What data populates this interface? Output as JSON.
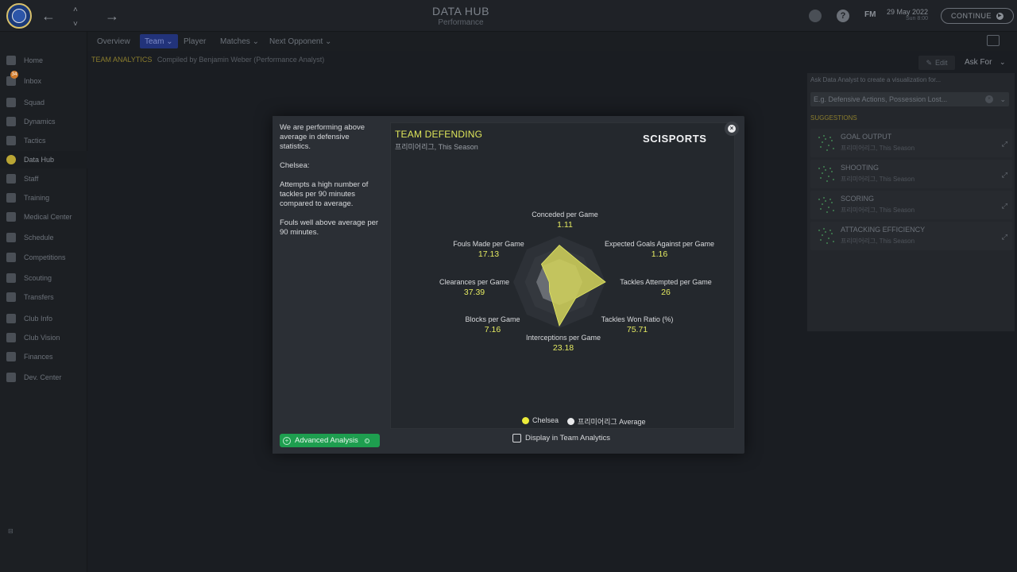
{
  "header": {
    "title": "DATA HUB",
    "subtitle": "Performance",
    "fm_label": "FM",
    "date": "29 May 2022",
    "time": "Sun 8:00",
    "continue_label": "CONTINUE"
  },
  "sidebar": {
    "inbox_count": "34",
    "items": [
      {
        "label": "Home",
        "icon": "home-icon"
      },
      {
        "label": "Inbox",
        "icon": "inbox-icon"
      },
      {
        "label": "Squad",
        "icon": "squad-icon"
      },
      {
        "label": "Dynamics",
        "icon": "dynamics-icon"
      },
      {
        "label": "Tactics",
        "icon": "tactics-icon"
      },
      {
        "label": "Data Hub",
        "icon": "data-hub-icon"
      },
      {
        "label": "Staff",
        "icon": "staff-icon"
      },
      {
        "label": "Training",
        "icon": "training-icon"
      },
      {
        "label": "Medical Center",
        "icon": "medical-icon"
      },
      {
        "label": "Schedule",
        "icon": "schedule-icon"
      },
      {
        "label": "Competitions",
        "icon": "trophy-icon"
      },
      {
        "label": "Scouting",
        "icon": "scouting-icon"
      },
      {
        "label": "Transfers",
        "icon": "transfers-icon"
      },
      {
        "label": "Club Info",
        "icon": "club-info-icon"
      },
      {
        "label": "Club Vision",
        "icon": "club-vision-icon"
      },
      {
        "label": "Finances",
        "icon": "finances-icon"
      },
      {
        "label": "Dev. Center",
        "icon": "dev-center-icon"
      }
    ]
  },
  "subnav": {
    "tabs": [
      "Overview",
      "Team",
      "Player",
      "Matches",
      "Next Opponent"
    ]
  },
  "breadcrumb": {
    "section": "TEAM ANALYTICS",
    "compiled_by": "Compiled by Benjamin Weber (Performance Analyst)"
  },
  "toolbar": {
    "edit_label": "Edit",
    "ask_for_label": "Ask For"
  },
  "right_panel": {
    "hint": "Ask Data Analyst to create a visualization for...",
    "placeholder": "E.g. Defensive Actions, Possession Lost...",
    "suggestions_label": "SUGGESTIONS",
    "suggestions": [
      {
        "title": "GOAL OUTPUT",
        "subtitle": "프리미어리그, This Season"
      },
      {
        "title": "SHOOTING",
        "subtitle": "프리미어리그, This Season"
      },
      {
        "title": "SCORING",
        "subtitle": "프리미어리그, This Season"
      },
      {
        "title": "ATTACKING EFFICIENCY",
        "subtitle": "프리미어리그, This Season"
      }
    ]
  },
  "modal": {
    "summary": "We are performing above average in defensive statistics.",
    "team": "Chelsea:",
    "point1": "Attempts a high number of tackles per 90 minutes compared to average.",
    "point2": "Fouls well above average per 90 minutes.",
    "advanced_label": "Advanced Analysis",
    "chart_title": "TEAM DEFENDING",
    "chart_subtitle": "프리미어리그, This Season",
    "brand": "SCISPORTS",
    "display_toggle_label": "Display in Team Analytics"
  },
  "colors": {
    "accent": "#dfe65a",
    "team_fill": "#d4d45a",
    "average_fill": "#e8e9eb",
    "advanced_button": "#1e9e4f"
  },
  "chart_data": {
    "type": "radar",
    "title": "TEAM DEFENDING",
    "subtitle": "프리미어리그, This Season",
    "axes": [
      {
        "label": "Conceded per Game",
        "value": "1.11"
      },
      {
        "label": "Expected Goals Against per Game",
        "value": "1.16"
      },
      {
        "label": "Tackles Attempted per Game",
        "value": "26"
      },
      {
        "label": "Tackles Won Ratio (%)",
        "value": "75.71"
      },
      {
        "label": "Interceptions per Game",
        "value": "23.18"
      },
      {
        "label": "Blocks per Game",
        "value": "7.16"
      },
      {
        "label": "Clearances per Game",
        "value": "37.39"
      },
      {
        "label": "Fouls Made per Game",
        "value": "17.13"
      }
    ],
    "series": [
      {
        "name": "Chelsea",
        "color": "#d4d45a",
        "relative": [
          0.8,
          0.62,
          1.0,
          0.5,
          0.95,
          0.3,
          0.22,
          0.55
        ]
      },
      {
        "name": "프리미어리그 Average",
        "color": "#e8e9eb",
        "relative": [
          0.5,
          0.5,
          0.5,
          0.5,
          0.5,
          0.5,
          0.5,
          0.5
        ]
      }
    ],
    "legend": "bottom"
  }
}
